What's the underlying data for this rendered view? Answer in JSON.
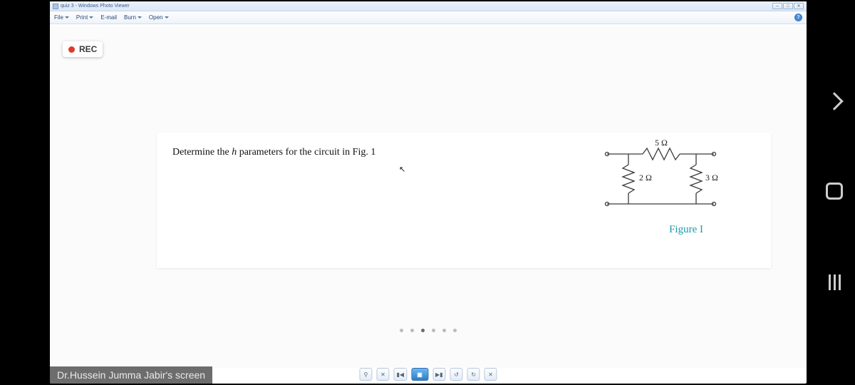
{
  "window": {
    "title": "quiz 3 - Windows Photo Viewer"
  },
  "menu": {
    "file": "File",
    "print": "Print",
    "email": "E-mail",
    "burn": "Burn",
    "open": "Open"
  },
  "help": "?",
  "rec": "REC",
  "problem": {
    "prefix": "Determine the ",
    "param": "h",
    "suffix": " parameters for the circuit in Fig. 1"
  },
  "circuit": {
    "r_top": "5 Ω",
    "r_left": "2 Ω",
    "r_right": "3 Ω",
    "figure_label": "Figure I"
  },
  "screenshare": "Dr.Hussein Jumma Jabir's screen",
  "controls": {
    "zoom": "⚲",
    "fit": "✕",
    "prev": "▮◀",
    "play": "▣",
    "next": "▶▮",
    "ccw": "↺",
    "cw": "↻",
    "del": "✕"
  },
  "win_buttons": {
    "min": "─",
    "max": "□",
    "close": "✕"
  }
}
